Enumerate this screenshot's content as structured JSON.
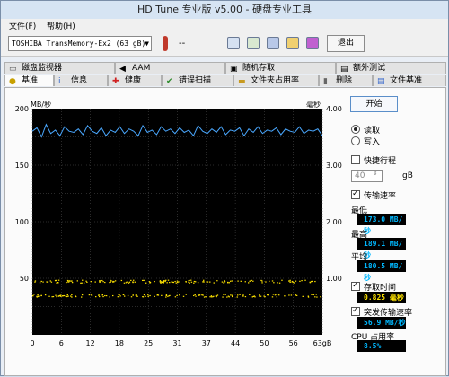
{
  "window": {
    "title": "HD Tune 专业版 v5.00 - 硬盘专业工具"
  },
  "menu": {
    "file": "文件(F)",
    "help": "帮助(H)"
  },
  "toolbar": {
    "drive": "TOSHIBA TransMemory-Ex2   (63 gB)",
    "temperature": "--",
    "exit_label": "退出"
  },
  "tabs_row1": [
    {
      "label": "磁盘监视器",
      "icon": "monitor-icon"
    },
    {
      "label": "AAM",
      "icon": "speaker-icon"
    },
    {
      "label": "随机存取",
      "icon": "random-access-icon"
    },
    {
      "label": "额外测试",
      "icon": "extra-tests-icon"
    }
  ],
  "tabs_row2": [
    {
      "label": "基准",
      "icon": "benchmark-icon",
      "active": true
    },
    {
      "label": "信息",
      "icon": "info-icon"
    },
    {
      "label": "健康",
      "icon": "health-icon"
    },
    {
      "label": "错误扫描",
      "icon": "error-scan-icon"
    },
    {
      "label": "文件夹占用率",
      "icon": "folder-usage-icon"
    },
    {
      "label": "删除",
      "icon": "erase-icon"
    },
    {
      "label": "文件基准",
      "icon": "file-benchmark-icon"
    }
  ],
  "chart_data": {
    "type": "line",
    "y_left_label": "MB/秒",
    "y_right_label": "毫秒",
    "y_left_ticks": [
      200,
      150,
      100,
      50
    ],
    "y_right_ticks": [
      "4.00",
      "3.00",
      "2.00",
      "1.00"
    ],
    "x_ticks": [
      "0",
      "6",
      "12",
      "18",
      "25",
      "31",
      "37",
      "44",
      "50",
      "56",
      "63gB"
    ],
    "ylim": [
      0,
      200
    ],
    "y2lim": [
      0,
      4
    ],
    "xlim": [
      0,
      63
    ],
    "series": [
      {
        "values": [
          180,
          183,
          175,
          186,
          178,
          181,
          176,
          184,
          180,
          179,
          182,
          177,
          185,
          180,
          178,
          183,
          176,
          181,
          179,
          184,
          178,
          182,
          180,
          176,
          185,
          179,
          181,
          177,
          184,
          180,
          182,
          178,
          183,
          179,
          181,
          176,
          185,
          180,
          178,
          182,
          179,
          184,
          177,
          181,
          180,
          183,
          176,
          182,
          179,
          184,
          178,
          181,
          180,
          183,
          177,
          182,
          180,
          179,
          184,
          178,
          181,
          180,
          182,
          176
        ]
      }
    ],
    "access_time_scatter": {
      "bands_ms": [
        0.95,
        0.7
      ],
      "color": "#ffe300"
    },
    "grid": true,
    "colors": {
      "background": "#000000",
      "grid": "#555555",
      "line": "#4aa8ff",
      "scatter": "#ffe300"
    }
  },
  "panel": {
    "start_label": "开始",
    "read_label": "读取",
    "write_label": "写入",
    "short_stroke_label": "快捷行程",
    "short_stroke_value": "40",
    "short_stroke_unit": "gB",
    "transfer_rate_label": "传输速率",
    "min_label": "最低",
    "min_value": "173.0 MB/秒",
    "max_label": "最高",
    "max_value": "189.1 MB/秒",
    "avg_label": "平均",
    "avg_value": "180.5 MB/秒",
    "access_time_label": "存取时间",
    "access_time_value": "0.825 毫秒",
    "burst_label": "突发传输速率",
    "burst_value": "56.9 MB/秒",
    "cpu_label": "CPU 占用率",
    "cpu_value": "8.5%"
  }
}
